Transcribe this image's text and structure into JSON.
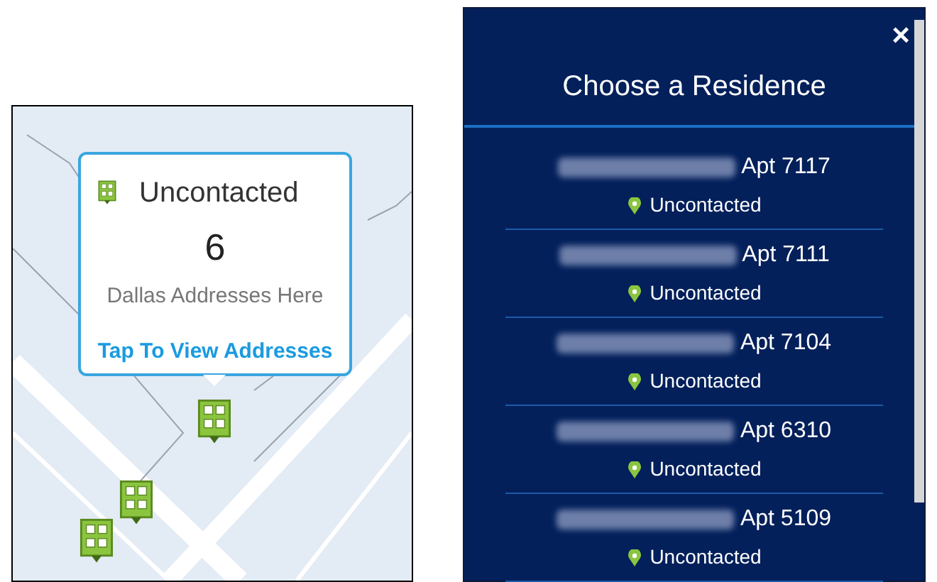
{
  "map_popup": {
    "status": "Uncontacted",
    "count": "6",
    "caption": "Dallas Addresses Here",
    "link": "Tap To View Addresses"
  },
  "residence_dialog": {
    "title": "Choose a Residence",
    "close": "×",
    "residences": [
      {
        "apt": "Apt 7117",
        "status": "Uncontacted"
      },
      {
        "apt": "Apt 7111",
        "status": "Uncontacted"
      },
      {
        "apt": "Apt 7104",
        "status": "Uncontacted"
      },
      {
        "apt": "Apt 6310",
        "status": "Uncontacted"
      },
      {
        "apt": "Apt 5109",
        "status": "Uncontacted"
      }
    ]
  }
}
